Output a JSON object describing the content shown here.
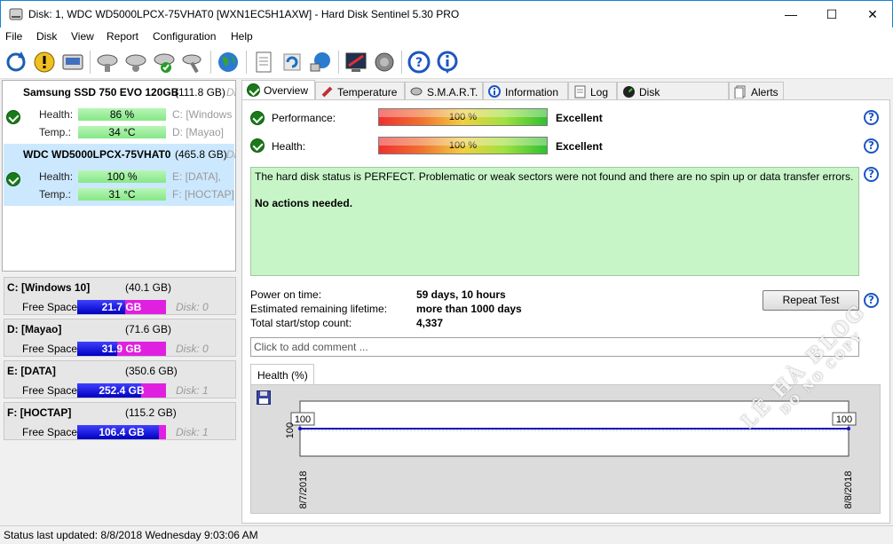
{
  "window": {
    "title": "Disk: 1, WDC WD5000LPCX-75VHAT0 [WXN1EC5H1AXW]  -  Hard Disk Sentinel 5.30 PRO",
    "minimize": "—",
    "maximize": "☐",
    "close": "✕"
  },
  "menu": [
    "File",
    "Disk",
    "View",
    "Report",
    "Configuration",
    "Help"
  ],
  "toolbar": {
    "icons": [
      "refresh-icon",
      "warning-icon",
      "disk-icon",
      "disk-test-icon",
      "disk-test-2-icon",
      "disk-ok-icon",
      "disk-wrench-icon",
      "globe-icon",
      "report-icon",
      "update-icon",
      "network-icon",
      "settings-icon",
      "sound-icon",
      "help-icon",
      "info-icon"
    ]
  },
  "disks": [
    {
      "name": "Samsung SSD 750 EVO 120GB",
      "size": "(111.8 GB)",
      "extra": "Di",
      "health_label": "Health:",
      "health": "86 %",
      "temp_label": "Temp.:",
      "temp": "34 °C",
      "part1": "C: [Windows",
      "part2": "D: [Mayao]"
    },
    {
      "name": "WDC WD5000LPCX-75VHAT0",
      "size": "(465.8 GB)",
      "extra": "Di",
      "health_label": "Health:",
      "health": "100 %",
      "temp_label": "Temp.:",
      "temp": "31 °C",
      "part1": "E: [DATA],",
      "part2": "F: [HOCTAP]"
    }
  ],
  "volumes": [
    {
      "name": "C: [Windows 10]",
      "size": "(40.1 GB)",
      "free_label": "Free Space",
      "free": "21.7 GB",
      "free_fraction": 0.54,
      "disk": "Disk: 0"
    },
    {
      "name": "D: [Mayao]",
      "size": "(71.6 GB)",
      "free_label": "Free Space",
      "free": "31.9 GB",
      "free_fraction": 0.45,
      "disk": "Disk: 0"
    },
    {
      "name": "E: [DATA]",
      "size": "(350.6 GB)",
      "free_label": "Free Space",
      "free": "252.4 GB",
      "free_fraction": 0.72,
      "disk": "Disk: 1"
    },
    {
      "name": "F: [HOCTAP]",
      "size": "(115.2 GB)",
      "free_label": "Free Space",
      "free": "106.4 GB",
      "free_fraction": 0.92,
      "disk": "Disk: 1"
    }
  ],
  "tabs": [
    "Overview",
    "Temperature",
    "S.M.A.R.T.",
    "Information",
    "Log",
    "Disk Performance",
    "Alerts"
  ],
  "overview": {
    "performance_label": "Performance:",
    "performance_value": "100 %",
    "performance_rating": "Excellent",
    "health_label": "Health:",
    "health_value": "100 %",
    "health_rating": "Excellent",
    "status_text": "The hard disk status is PERFECT. Problematic or weak sectors were not found and there are no spin up or data transfer errors.",
    "status_action": "No actions needed.",
    "power_on_label": "Power on time:",
    "power_on_value": "59 days, 10 hours",
    "lifetime_label": "Estimated remaining lifetime:",
    "lifetime_value": "more than 1000 days",
    "startstop_label": "Total start/stop count:",
    "startstop_value": "4,337",
    "repeat_test": "Repeat Test",
    "comment_placeholder": "Click to add comment ...",
    "help": "?"
  },
  "chart_data": {
    "type": "line",
    "title": "Health (%)",
    "x": [
      "8/7/2018",
      "8/8/2018"
    ],
    "series": [
      {
        "values": [
          100,
          100
        ]
      }
    ],
    "data_labels": [
      "100",
      "100"
    ],
    "ytick": "100",
    "xtick_first": "8/7/2018",
    "xtick_last": "8/8/2018",
    "color": "#1010c0"
  },
  "status_bar": "Status last updated: 8/8/2018 Wednesday 9:03:06 AM",
  "watermark": {
    "line1": "LÊ HÀ BLOG",
    "line2": "DO NO COPY"
  },
  "colors": {
    "ok_green": "#1a7a1a",
    "status_bg": "#c8f5c8",
    "free_bar": "#e020e0",
    "accent": "#1c56c4"
  }
}
